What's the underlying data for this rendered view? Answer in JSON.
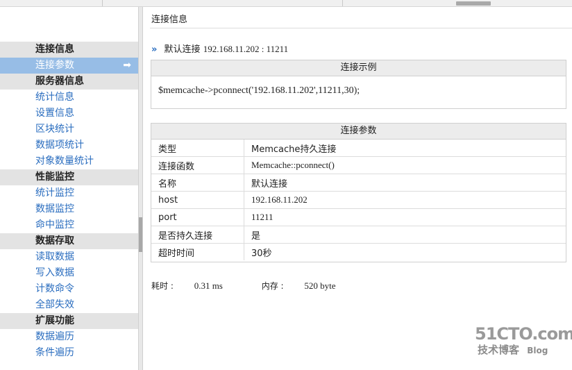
{
  "sidebar": {
    "groups": [
      {
        "title": "连接信息",
        "items": [
          "连接参数"
        ]
      },
      {
        "title": "服务器信息",
        "items": [
          "统计信息",
          "设置信息",
          "区块统计",
          "数据项统计",
          "对象数量统计"
        ]
      },
      {
        "title": "性能监控",
        "items": [
          "统计监控",
          "数据监控",
          "命中监控"
        ]
      },
      {
        "title": "数据存取",
        "items": [
          "读取数据",
          "写入数据",
          "计数命令",
          "全部失效"
        ]
      },
      {
        "title": "扩展功能",
        "items": [
          "数据遍历",
          "条件遍历"
        ]
      }
    ],
    "active_item": "连接参数",
    "active_arrow": "➡"
  },
  "main": {
    "title": "连接信息",
    "connection": {
      "chevron": "»",
      "label": "默认连接",
      "address": "192.168.11.202 : 11211"
    },
    "example": {
      "header": "连接示例",
      "code": "$memcache->pconnect('192.168.11.202',11211,30);"
    },
    "params": {
      "header": "连接参数",
      "rows": [
        {
          "key": "类型",
          "value": "Memcache持久连接"
        },
        {
          "key": "连接函数",
          "value": "Memcache::pconnect()"
        },
        {
          "key": "名称",
          "value": "默认连接"
        },
        {
          "key": "host",
          "value": "192.168.11.202"
        },
        {
          "key": "port",
          "value": "11211"
        },
        {
          "key": "是否持久连接",
          "value": "是"
        },
        {
          "key": "超时时间",
          "value": "30秒"
        }
      ]
    },
    "footer": {
      "time_label": "耗时 :",
      "time_value": "0.31 ms",
      "mem_label": "内存 :",
      "mem_value": "520 byte"
    }
  },
  "watermark": {
    "logo": "51CTO.com",
    "sub": "技术博客",
    "blog": "Blog"
  },
  "colors": {
    "link": "#2a6dbf",
    "active_bg": "#97bde6",
    "group_bg": "#e3e3e3"
  }
}
